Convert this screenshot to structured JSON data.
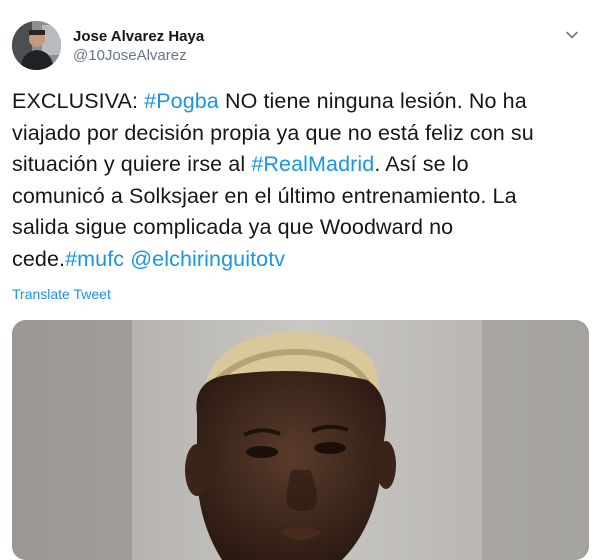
{
  "author": {
    "display_name": "Jose Alvarez Haya",
    "handle": "@10JoseAlvarez"
  },
  "tweet": {
    "segments": [
      [
        {
          "text": "EXCLUSIVA: ",
          "type": "text"
        },
        {
          "text": "#Pogba",
          "type": "hashtag"
        },
        {
          "text": " NO tiene ninguna lesión. No ha",
          "type": "text"
        }
      ],
      [
        {
          "text": "viajado por decisión propia ya que no está feliz con su",
          "type": "text"
        }
      ],
      [
        {
          "text": "situación y quiere irse al ",
          "type": "text"
        },
        {
          "text": "#RealMadrid",
          "type": "hashtag"
        },
        {
          "text": ". Así se lo",
          "type": "text"
        }
      ],
      [
        {
          "text": "comunicó a Solksjaer en el último entrenamiento. La",
          "type": "text"
        }
      ],
      [
        {
          "text": "salida sigue complicada ya que Woodward no",
          "type": "text"
        }
      ],
      [
        {
          "text": "cede.",
          "type": "text"
        },
        {
          "text": "#mufc",
          "type": "hashtag"
        },
        {
          "text": " ",
          "type": "text"
        },
        {
          "text": "@elchiringuitotv",
          "type": "mention"
        }
      ]
    ]
  },
  "translate_label": "Translate Tweet",
  "colors": {
    "link": "#1b95e0",
    "text": "#14171a",
    "secondary": "#657786"
  },
  "icons": {
    "menu": "chevron-down-icon"
  }
}
